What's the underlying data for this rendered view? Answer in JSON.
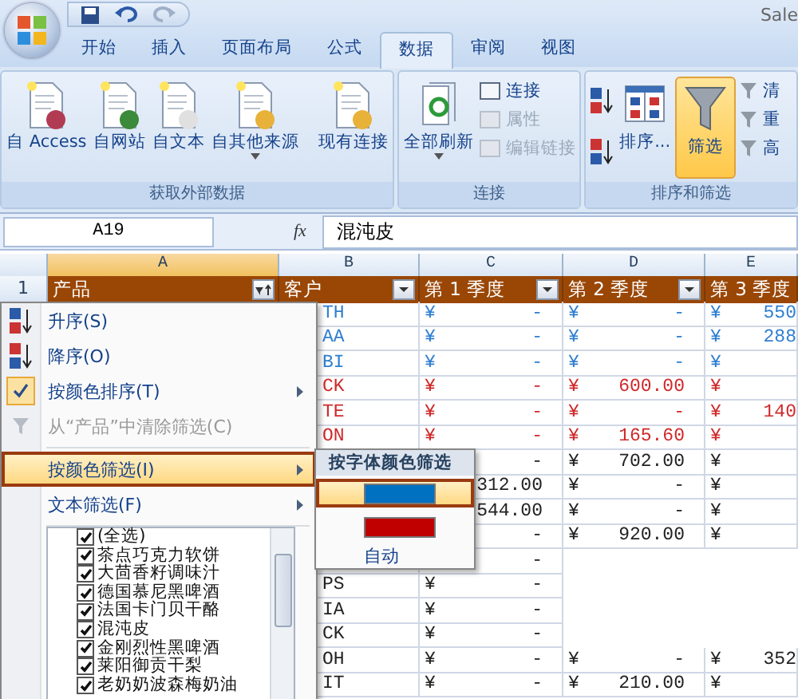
{
  "title": "Sale",
  "tabs": [
    {
      "label": "开始",
      "selected": false
    },
    {
      "label": "插入",
      "selected": false
    },
    {
      "label": "页面布局",
      "selected": false
    },
    {
      "label": "公式",
      "selected": false
    },
    {
      "label": "数据",
      "selected": true
    },
    {
      "label": "审阅",
      "selected": false
    },
    {
      "label": "视图",
      "selected": false
    }
  ],
  "external_data": {
    "label": "获取外部数据",
    "buttons": [
      {
        "label": "自 Access",
        "dropdown": false
      },
      {
        "label": "自网站",
        "dropdown": false
      },
      {
        "label": "自文本",
        "dropdown": false
      },
      {
        "label": "自其他来源",
        "dropdown": true
      },
      {
        "label": "现有连接",
        "dropdown": false
      }
    ]
  },
  "connections": {
    "label": "连接",
    "refresh": "全部刷新",
    "items": [
      {
        "label": "连接",
        "disabled": false
      },
      {
        "label": "属性",
        "disabled": true
      },
      {
        "label": "编辑链接",
        "disabled": true
      }
    ]
  },
  "sort_filter": {
    "label": "排序和筛选",
    "sort": "排序...",
    "filter": {
      "label": "筛选",
      "active": true
    },
    "items": [
      "清",
      "重",
      "高"
    ]
  },
  "name_box": "A19",
  "function_label": "fx",
  "formula": "混沌皮",
  "columns": [
    {
      "label": "A",
      "selected": true
    },
    {
      "label": "B",
      "selected": false
    },
    {
      "label": "C",
      "selected": false
    },
    {
      "label": "D",
      "selected": false
    },
    {
      "label": "E",
      "selected": false
    }
  ],
  "header_row": {
    "number": "1",
    "cells": [
      {
        "label": "产品",
        "kind": "filtered"
      },
      {
        "label": "客户",
        "kind": "plain"
      },
      {
        "label": "第 1 季度",
        "kind": "plain"
      },
      {
        "label": "第 2 季度",
        "kind": "plain"
      },
      {
        "label": "第 3 季度"
      }
    ]
  },
  "rows": [
    {
      "color": "#2f7fd0",
      "b": "TH",
      "c": {
        "sym": "¥",
        "amt": "-"
      },
      "d": {
        "sym": "¥",
        "amt": "-"
      },
      "e": {
        "sym": "¥",
        "amt": "550"
      }
    },
    {
      "color": "#2f7fd0",
      "b": "AA",
      "c": {
        "sym": "¥",
        "amt": "-"
      },
      "d": {
        "sym": "¥",
        "amt": "-"
      },
      "e": {
        "sym": "¥",
        "amt": "288"
      }
    },
    {
      "color": "#2f7fd0",
      "b": "BI",
      "c": {
        "sym": "¥",
        "amt": "-"
      },
      "d": {
        "sym": "¥",
        "amt": "-"
      },
      "e": {
        "sym": "¥"
      }
    },
    {
      "color": "#d0282a",
      "b": "CK",
      "c": {
        "sym": "¥",
        "amt": "-"
      },
      "d": {
        "sym": "¥",
        "amt": "600.00"
      },
      "e": {
        "sym": "¥"
      }
    },
    {
      "color": "#d0282a",
      "b": "TE",
      "c": {
        "sym": "¥",
        "amt": "-"
      },
      "d": {
        "sym": "¥",
        "amt": "-"
      },
      "e": {
        "sym": "¥",
        "amt": "140"
      }
    },
    {
      "color": "#d0282a",
      "b": "ON",
      "c": {
        "sym": "¥",
        "amt": "-"
      },
      "d": {
        "sym": "¥",
        "amt": "165.60"
      },
      "e": {
        "sym": "¥"
      }
    },
    {
      "color": "#222222",
      "c": {
        "amt": "-"
      },
      "d": {
        "sym": "¥",
        "amt": "702.00"
      },
      "e": {
        "sym": "¥"
      }
    },
    {
      "color": "#222222",
      "c": {
        "amt": "312.00"
      },
      "d": {
        "sym": "¥",
        "amt": "-"
      },
      "e": {
        "sym": "¥"
      }
    },
    {
      "color": "#222222",
      "c": {
        "amt": "544.00"
      },
      "d": {
        "sym": "¥",
        "amt": "-"
      },
      "e": {
        "sym": "¥"
      }
    },
    {
      "color": "#222222",
      "c": {
        "amt": "-"
      },
      "d": {
        "sym": "¥",
        "amt": "920.00"
      },
      "e": {
        "sym": "¥"
      }
    },
    {
      "color": "#222222",
      "c": {
        "amt": "-"
      }
    },
    {
      "color": "#222222",
      "b": "PS",
      "c": {
        "sym": "¥",
        "amt": "-"
      }
    },
    {
      "color": "#222222",
      "b": "IA",
      "c": {
        "sym": "¥",
        "amt": "-"
      }
    },
    {
      "color": "#222222",
      "b": "CK",
      "c": {
        "sym": "¥",
        "amt": "-"
      }
    },
    {
      "color": "#222222",
      "b": "OH",
      "c": {
        "sym": "¥",
        "amt": "-"
      },
      "d": {
        "sym": "¥",
        "amt": "-"
      },
      "e": {
        "sym": "¥",
        "amt": "352"
      }
    },
    {
      "color": "#222222",
      "b": "IT",
      "c": {
        "sym": "¥",
        "amt": "-"
      },
      "d": {
        "sym": "¥",
        "amt": "210.00"
      },
      "e": {
        "sym": "¥"
      }
    }
  ],
  "filter_menu": {
    "items": [
      {
        "kind": "sort-asc",
        "label": "升序(S)",
        "submenu": false,
        "checked": false,
        "disabled": false,
        "selected": false
      },
      {
        "kind": "sort-desc",
        "label": "降序(O)",
        "submenu": false,
        "checked": false,
        "disabled": false,
        "selected": false
      },
      {
        "kind": "plain",
        "label": "按颜色排序(T)",
        "submenu": true,
        "checked": true,
        "disabled": false,
        "selected": false
      },
      {
        "kind": "clear",
        "label": "从“产品”中清除筛选(C)",
        "submenu": false,
        "checked": false,
        "disabled": true,
        "selected": false
      },
      {
        "kind": "plain",
        "label": "按颜色筛选(I)",
        "submenu": true,
        "checked": false,
        "disabled": false,
        "selected": true
      },
      {
        "kind": "plain",
        "label": "文本筛选(F)",
        "submenu": true,
        "checked": false,
        "disabled": false,
        "selected": false
      }
    ],
    "values": [
      {
        "label": "(全选)",
        "checked": true
      },
      {
        "label": "茶点巧克力软饼",
        "checked": true
      },
      {
        "label": "大茴香籽调味汁",
        "checked": true
      },
      {
        "label": "德国慕尼黑啤酒",
        "checked": true
      },
      {
        "label": "法国卡门贝干酪",
        "checked": true
      },
      {
        "label": "混沌皮",
        "checked": true
      },
      {
        "label": "金刚烈性黑啤酒",
        "checked": true
      },
      {
        "label": "莱阳御贡干梨",
        "checked": true
      },
      {
        "label": "老奶奶波森梅奶油",
        "checked": true
      }
    ]
  },
  "color_submenu": {
    "title": "按字体颜色筛选",
    "swatches": [
      {
        "color": "#0070c0",
        "selected": true
      },
      {
        "color": "#c00000",
        "selected": false
      }
    ],
    "auto": "自动"
  }
}
